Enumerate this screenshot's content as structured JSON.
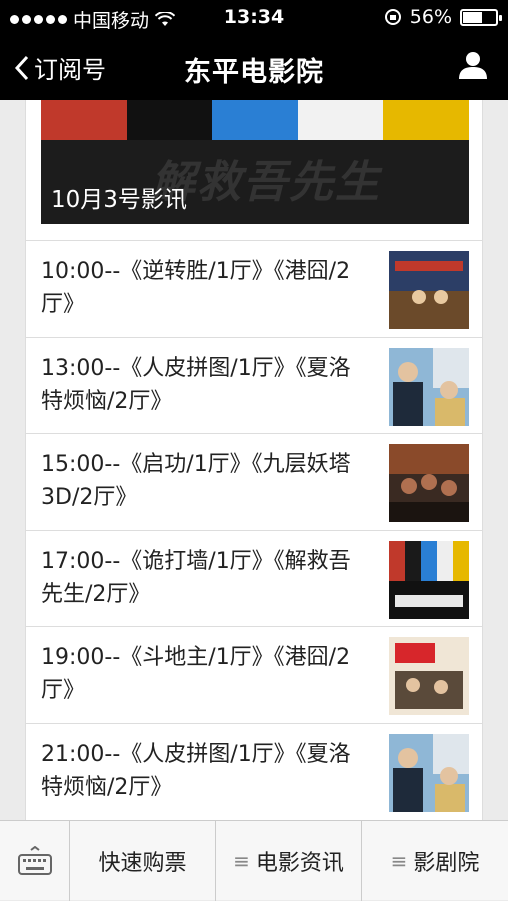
{
  "status": {
    "carrier": "中国移动",
    "time": "13:34",
    "battery_text": "56%",
    "battery_level": 0.56
  },
  "nav": {
    "back_label": "订阅号",
    "title": "东平电影院"
  },
  "cover": {
    "caption": "10月3号影讯",
    "poster_title": "解救吾先生"
  },
  "items": [
    {
      "text": "10:00--《逆转胜/1厅》《港囧/2厅》"
    },
    {
      "text": "13:00--《人皮拼图/1厅》《夏洛特烦恼/2厅》"
    },
    {
      "text": "15:00--《启功/1厅》《九层妖塔3D/2厅》"
    },
    {
      "text": "17:00--《诡打墙/1厅》《解救吾先生/2厅》"
    },
    {
      "text": "19:00--《斗地主/1厅》《港囧/2厅》"
    },
    {
      "text": "21:00--《人皮拼图/1厅》《夏洛特烦恼/2厅》"
    }
  ],
  "tabbar": {
    "tab1": "快速购票",
    "tab2": "电影资讯",
    "tab3": "影剧院"
  }
}
